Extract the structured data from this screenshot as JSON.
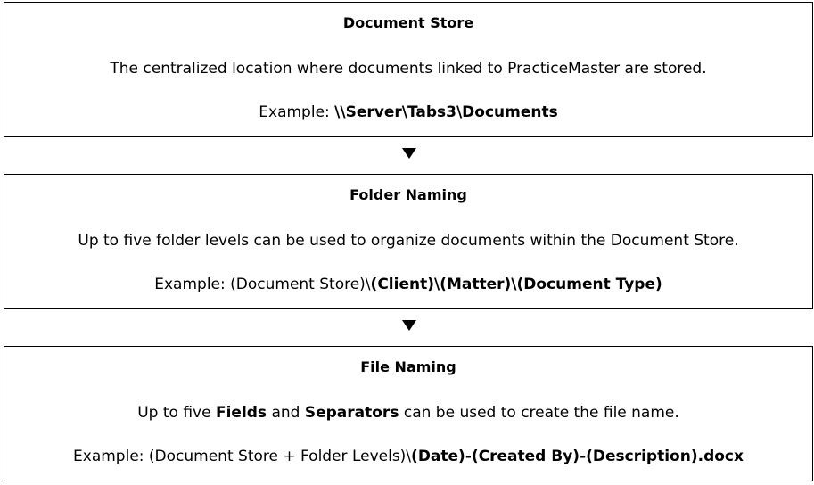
{
  "document_store": {
    "title": "Document Store",
    "description": "The centralized location where documents linked to PracticeMaster are stored.",
    "example_prefix": "Example: ",
    "example_value": "\\\\Server\\Tabs3\\Documents"
  },
  "folder_naming": {
    "title": "Folder Naming",
    "description": "Up to five folder levels can be used to organize documents within the Document Store.",
    "example_prefix": "Example: (Document Store)\\",
    "example_value": "(Client)\\(Matter)\\(Document Type)"
  },
  "file_naming": {
    "title": "File Naming",
    "description_part1": "Up to five ",
    "description_fields": "Fields",
    "description_part2": " and ",
    "description_separators": "Separators",
    "description_part3": " can be used to create the file name.",
    "example_prefix": "Example: (Document Store + Folder Levels)\\",
    "example_value": "(Date)-(Created By)-(Description).docx"
  },
  "arrows": {
    "down_arrow_glyph": "▼"
  }
}
